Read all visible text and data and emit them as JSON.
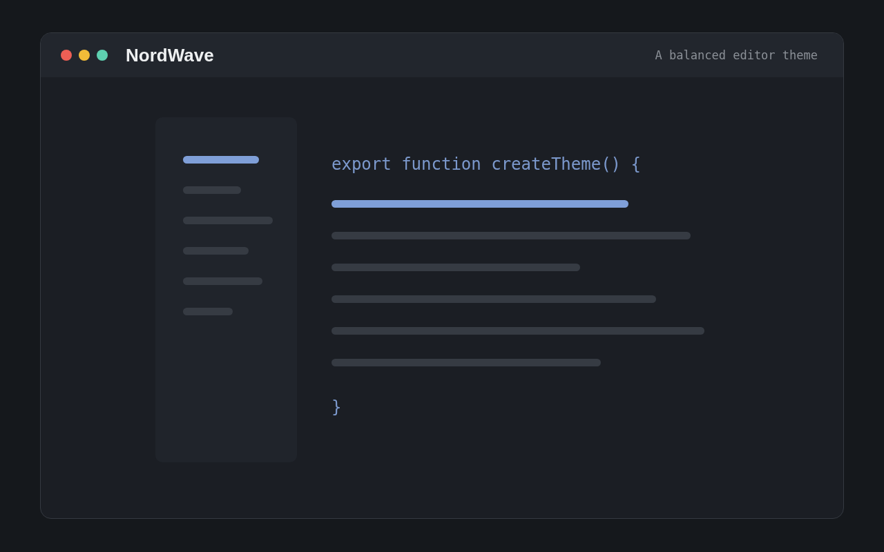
{
  "window": {
    "controls": [
      {
        "color": "#ee5f55"
      },
      {
        "color": "#f1bc38"
      },
      {
        "color": "#5ed0b0"
      }
    ],
    "title": "NordWave",
    "subtitle": "A balanced editor theme"
  },
  "sidebar": {
    "items": [
      {
        "selected": true
      },
      {
        "selected": false
      },
      {
        "selected": false
      },
      {
        "selected": false
      },
      {
        "selected": false
      },
      {
        "selected": false
      }
    ]
  },
  "editor": {
    "first_line": "export function createTheme() {",
    "lines": [
      {
        "selected": true
      },
      {
        "selected": false
      },
      {
        "selected": false
      },
      {
        "selected": false
      },
      {
        "selected": false
      },
      {
        "selected": false
      }
    ],
    "last_line": "}"
  }
}
